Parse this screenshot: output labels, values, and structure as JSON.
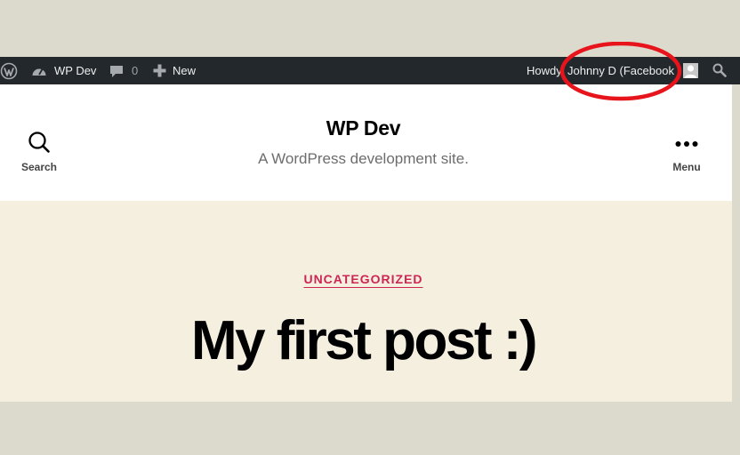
{
  "admin_bar": {
    "site_name": "WP Dev",
    "comments_count": "0",
    "new_label": "New",
    "howdy_text": "Howdy, Johnny D (Facebook"
  },
  "header": {
    "site_title": "WP Dev",
    "site_description": "A WordPress development site.",
    "search_label": "Search",
    "menu_label": "Menu"
  },
  "post": {
    "category": "UNCATEGORIZED",
    "title": "My first post :)"
  },
  "icons": {
    "wp_logo": "wordpress-logo-icon",
    "dashboard": "dashboard-icon",
    "comments": "comment-bubble-icon",
    "new": "plus-icon",
    "avatar": "avatar-icon",
    "admin_search": "search-icon",
    "header_search": "search-icon",
    "menu": "ellipsis-icon"
  },
  "colors": {
    "admin_bar_bg": "#23282d",
    "accent": "#cd2653",
    "main_bg": "#f5efe0",
    "annotation": "#e8141b"
  }
}
